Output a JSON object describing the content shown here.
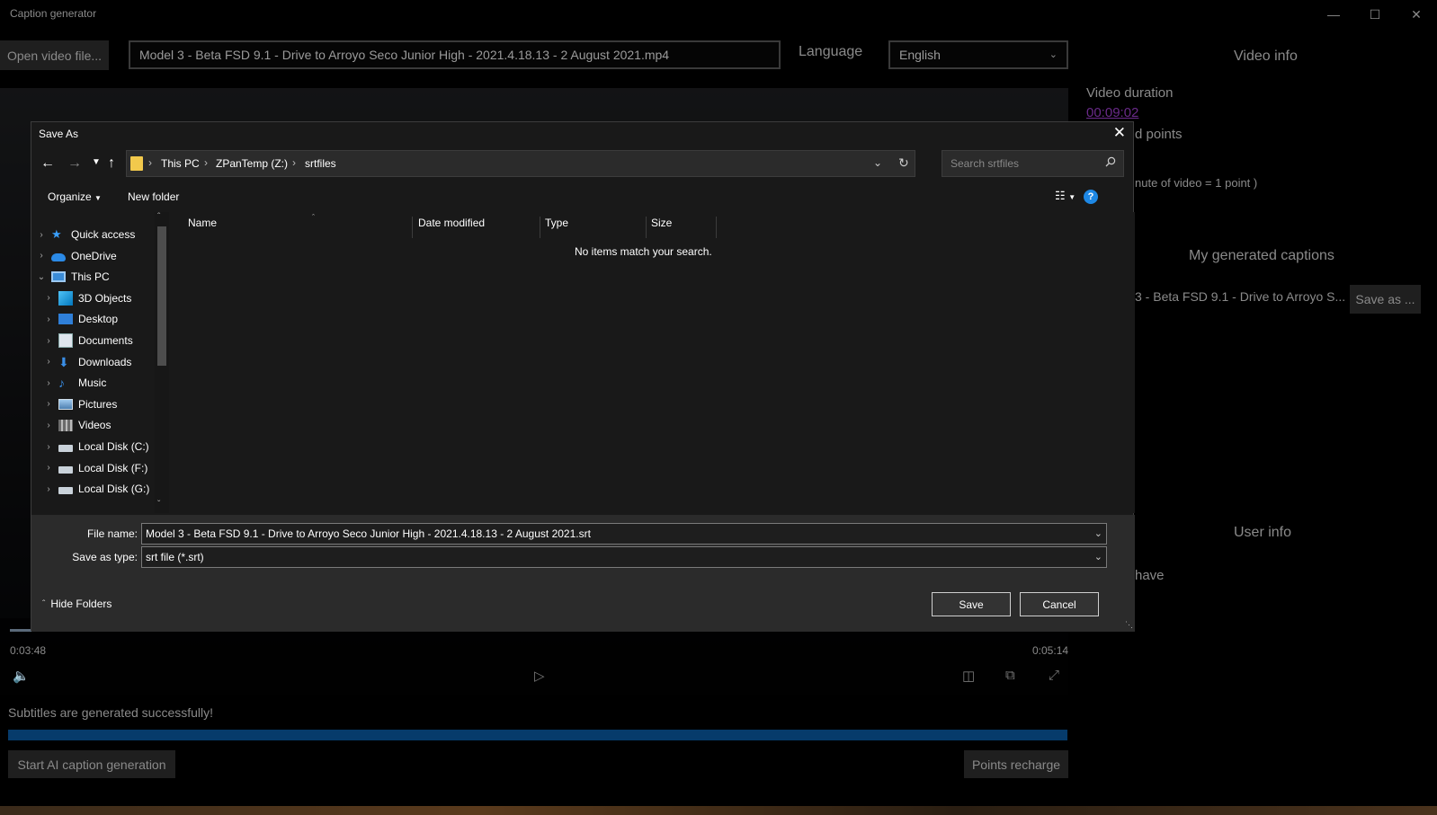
{
  "app": {
    "title": "Caption generator",
    "open_button": "Open video file...",
    "file_path": "Model 3 - Beta FSD 9.1 - Drive to Arroyo Seco Junior High - 2021.4.18.13 - 2 August 2021.mp4",
    "language_label": "Language",
    "language_value": "English",
    "player": {
      "current_time": "0:03:48",
      "total_time": "0:05:14",
      "seek_fraction": 0.42
    },
    "status_text": "Subtitles are generated successfully!",
    "progress_fraction": 1.0,
    "start_button": "Start AI caption generation",
    "recharge_button": "Points recharge",
    "side": {
      "video_info_heading": "Video info",
      "video_duration_label": "Video duration",
      "video_duration_value": "00:09:02",
      "points_partial": "d points",
      "minute_partial": "nute of video = 1 point )",
      "captions_heading": "My generated captions",
      "caption_item": "3 - Beta FSD 9.1 - Drive to Arroyo S...",
      "save_as_button": "Save as ...",
      "user_info_heading": "User info",
      "have_partial": "have"
    },
    "accent_colors": {
      "progress": "#063b6b",
      "duration_link": "#6a2a8a"
    }
  },
  "dialog": {
    "title": "Save As",
    "address": [
      "This PC",
      "ZPanTemp (Z:)",
      "srtfiles"
    ],
    "search_placeholder": "Search srtfiles",
    "toolbar": {
      "organize": "Organize",
      "new_folder": "New folder"
    },
    "nav_items": [
      {
        "label": "Quick access",
        "icon": "star-icon",
        "level": 0,
        "expanded": false
      },
      {
        "label": "OneDrive",
        "icon": "cloud-icon",
        "level": 0,
        "expanded": false
      },
      {
        "label": "This PC",
        "icon": "computer-icon",
        "level": 0,
        "expanded": true
      },
      {
        "label": "3D Objects",
        "icon": "cube-icon",
        "level": 1,
        "expanded": false
      },
      {
        "label": "Desktop",
        "icon": "desktop-icon",
        "level": 1,
        "expanded": false
      },
      {
        "label": "Documents",
        "icon": "document-icon",
        "level": 1,
        "expanded": false
      },
      {
        "label": "Downloads",
        "icon": "download-icon",
        "level": 1,
        "expanded": false
      },
      {
        "label": "Music",
        "icon": "music-icon",
        "level": 1,
        "expanded": false
      },
      {
        "label": "Pictures",
        "icon": "picture-icon",
        "level": 1,
        "expanded": false
      },
      {
        "label": "Videos",
        "icon": "video-icon",
        "level": 1,
        "expanded": false
      },
      {
        "label": "Local Disk (C:)",
        "icon": "drive-icon",
        "level": 1,
        "expanded": false
      },
      {
        "label": "Local Disk (F:)",
        "icon": "drive-icon",
        "level": 1,
        "expanded": false
      },
      {
        "label": "Local Disk (G:)",
        "icon": "drive-icon",
        "level": 1,
        "expanded": false
      }
    ],
    "columns": [
      "Name",
      "Date modified",
      "Type",
      "Size"
    ],
    "empty_message": "No items match your search.",
    "file_name_label": "File name:",
    "file_name_value": "Model 3 - Beta FSD 9.1 - Drive to Arroyo Seco Junior High - 2021.4.18.13 - 2 August 2021.srt",
    "save_type_label": "Save as type:",
    "save_type_value": "srt file (*.srt)",
    "hide_folders": "Hide Folders",
    "save_button": "Save",
    "cancel_button": "Cancel"
  }
}
